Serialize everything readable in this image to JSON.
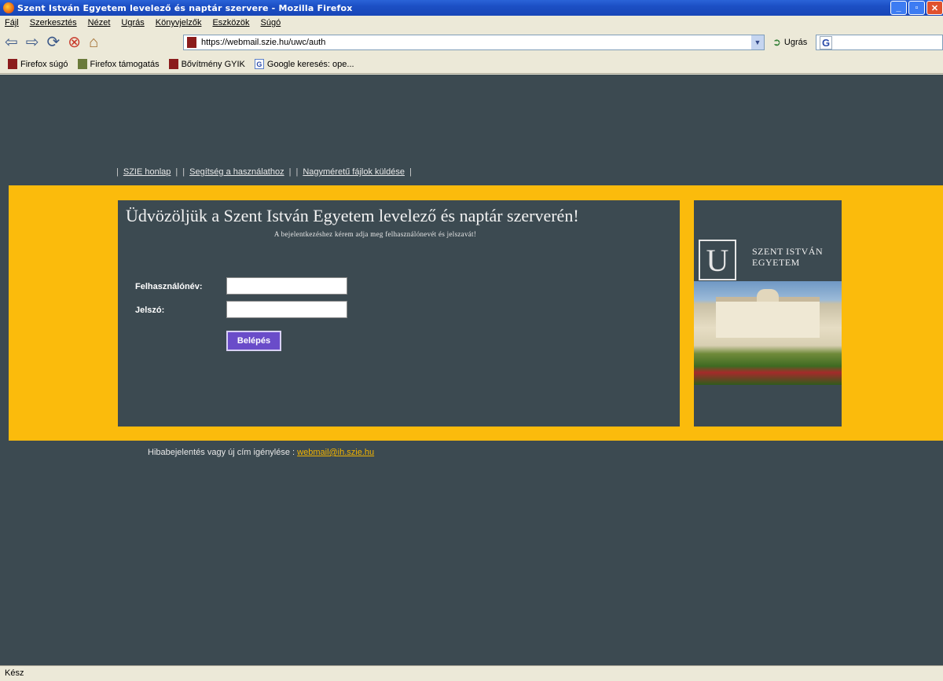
{
  "window": {
    "title": "Szent István Egyetem levelező és naptár szervere - Mozilla Firefox"
  },
  "menu": [
    "Fájl",
    "Szerkesztés",
    "Nézet",
    "Ugrás",
    "Könyvjelzők",
    "Eszközök",
    "Súgó"
  ],
  "nav": {
    "url": "https://webmail.szie.hu/uwc/auth",
    "go_label": "Ugrás"
  },
  "bookmarks": [
    "Firefox súgó",
    "Firefox támogatás",
    "Bővítmény GYIK",
    "Google keresés: ope..."
  ],
  "toplinks": [
    "SZIE honlap",
    "Segítség a használathoz",
    "Nagyméretű fájlok küldése"
  ],
  "login": {
    "welcome": "Üdvözöljük a Szent István Egyetem levelező és naptár szerverén!",
    "subtext": "A bejelentkezéshez kérem adja meg felhasználónevét és jelszavát!",
    "username_label": "Felhasználónév:",
    "password_label": "Jelszó:",
    "username_value": "",
    "password_value": "",
    "submit_label": "Belépés"
  },
  "side": {
    "logo_line1": "SZENT ISTVÁN",
    "logo_line2": "EGYETEM"
  },
  "footer": {
    "text": "Hibabejelentés vagy új cím igénylése : ",
    "email": "webmail@ih.szie.hu"
  },
  "status": "Kész"
}
